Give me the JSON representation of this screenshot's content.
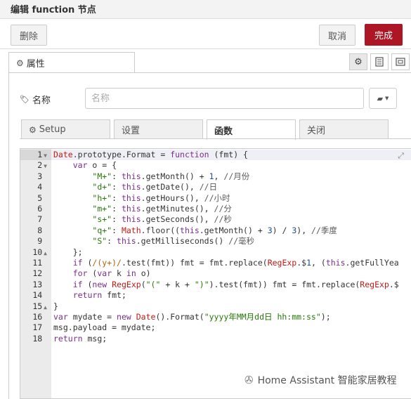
{
  "window": {
    "title": "编辑 function 节点"
  },
  "toolbar": {
    "delete_label": "删除",
    "cancel_label": "取消",
    "done_label": "完成"
  },
  "props_tab": {
    "label": "属性"
  },
  "name_field": {
    "label": "名称",
    "placeholder": "名称",
    "value": ""
  },
  "subtabs": [
    {
      "label": "Setup",
      "active": false
    },
    {
      "label": "设置",
      "active": false
    },
    {
      "label": "函数",
      "active": true
    },
    {
      "label": "关闭",
      "active": false
    }
  ],
  "editor": {
    "active_line": 1,
    "line_numbers": [
      "1",
      "2",
      "3",
      "4",
      "5",
      "6",
      "7",
      "8",
      "9",
      "10",
      "11",
      "12",
      "13",
      "14",
      "15",
      "16",
      "17",
      "18"
    ],
    "folded": [
      1,
      2,
      10,
      15
    ],
    "lines": [
      "Date.prototype.Format = function (fmt) {",
      "    var o = {",
      "        \"M+\": this.getMonth() + 1, //月份",
      "        \"d+\": this.getDate(), //日",
      "        \"h+\": this.getHours(), //小时",
      "        \"m+\": this.getMinutes(), //分",
      "        \"s+\": this.getSeconds(), //秒",
      "        \"q+\": Math.floor((this.getMonth() + 3) / 3), //季度",
      "        \"S\": this.getMilliseconds() //毫秒",
      "    };",
      "    if (/(y+)/.test(fmt)) fmt = fmt.replace(RegExp.$1, (this.getFullYea",
      "    for (var k in o)",
      "    if (new RegExp(\"(\" + k + \")\").test(fmt)) fmt = fmt.replace(RegExp.$",
      "    return fmt;",
      "}",
      "var mydate = new Date().Format(\"yyyy年MM月dd日 hh:mm:ss\");",
      "msg.payload = mydate;",
      "return msg;"
    ]
  },
  "watermark": {
    "text": "Home Assistant 智能家居教程"
  },
  "icons": {
    "gear": "gear-icon",
    "book": "book-icon",
    "layout": "layout-icon",
    "tag": "tag-icon",
    "expand": "expand-icon",
    "wechat": "wechat-icon"
  },
  "colors": {
    "done_button": "#ad1625",
    "titlebar": "#f3f3f3",
    "gutter": "#ebebeb"
  }
}
